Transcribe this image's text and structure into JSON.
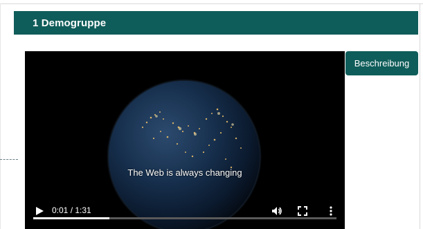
{
  "section": {
    "title": "1 Demogruppe",
    "header_color": "#0f5d5a"
  },
  "video": {
    "caption": "The Web is always changing",
    "time_display": "0:01 / 1:31",
    "progress_fraction": 0.25,
    "controls": [
      "play-icon",
      "volume-icon",
      "fullscreen-icon",
      "more-options-icon"
    ]
  },
  "side_button": {
    "label": "Beschreibung"
  }
}
